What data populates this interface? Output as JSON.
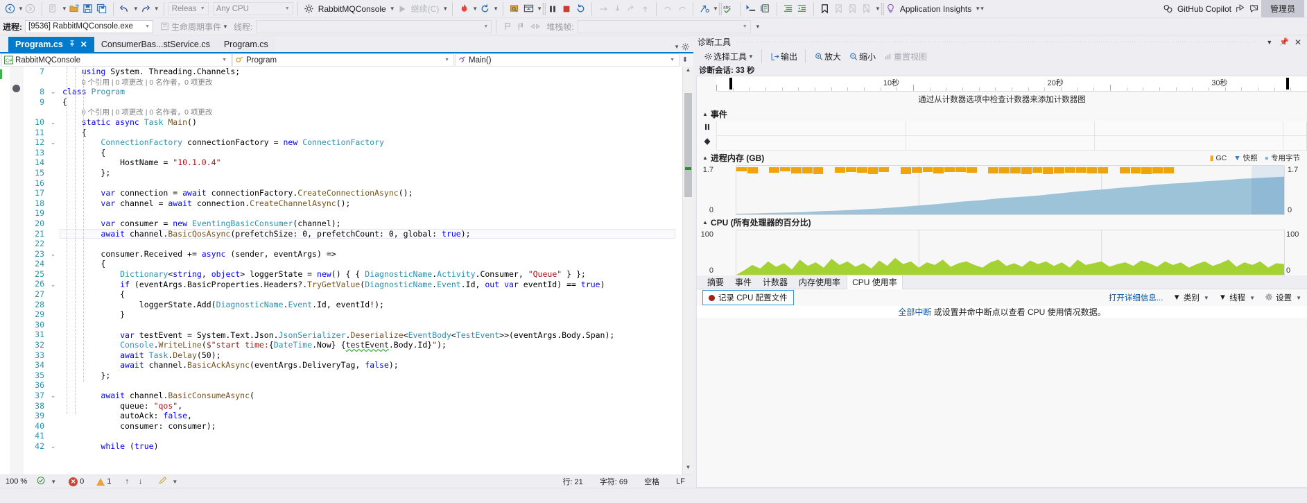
{
  "toolbar": {
    "nav_back": "◀",
    "nav_fwd": "▶",
    "config": "Release",
    "platform": "Any CPU",
    "start_project": "RabbitMQConsole",
    "continue_label": "继续(C)",
    "app_insights": "Application Insights",
    "github_copilot": "GitHub Copilot",
    "admin": "管理员",
    "icons": {
      "back": "back-arrow-icon",
      "forward": "forward-arrow-icon",
      "new_item": "new-item-icon",
      "open": "open-folder-icon",
      "save": "save-icon",
      "save_all": "save-all-icon",
      "undo": "undo-icon",
      "redo": "redo-icon",
      "hot_reload": "hot-reload-icon",
      "restart": "restart-icon",
      "step": "step-icon",
      "break_all": "pause-icon",
      "stop": "stop-icon",
      "restart_debug": "restart-debug-icon",
      "step_into": "step-into-icon",
      "step_over": "step-over-icon",
      "step_out": "step-out-icon",
      "spell": "spell-check-icon",
      "bookmark": "bookmark-icon",
      "lightbulb": "lightbulb-icon"
    }
  },
  "process_bar": {
    "process_label": "进程:",
    "process_value": "[9536] RabbitMQConsole.exe",
    "lifecycle_label": "生命周期事件",
    "thread_label": "线程:",
    "thread_value": "",
    "stackframe_label": "堆栈帧:",
    "stackframe_value": ""
  },
  "tabs": [
    {
      "label": "Program.cs",
      "active": true,
      "pin": "📌",
      "close": "✕"
    },
    {
      "label": "ConsumerBas...stService.cs",
      "active": false
    },
    {
      "label": "Program.cs",
      "active": false
    }
  ],
  "navbar": {
    "project": "RabbitMQConsole",
    "type": "Program",
    "member": "Main()"
  },
  "editor": {
    "first_line": 7,
    "lines": [
      {
        "n": 7,
        "indent": 4,
        "tokens": [
          [
            "kw",
            "using "
          ],
          [
            "pl",
            "System"
          ],
          [
            "pl",
            ". "
          ],
          [
            "pl",
            "Threading"
          ],
          [
            "pl",
            "."
          ],
          [
            "pl",
            "Channels"
          ],
          [
            "pl",
            ";"
          ]
        ]
      },
      {
        "n": null,
        "indent": 4,
        "codelens": "0 个引用 | 0 项更改 | 0 名作者，0 项更改"
      },
      {
        "n": 8,
        "indent": 0,
        "fold": true,
        "tokens": [
          [
            "kw",
            "class "
          ],
          [
            "typ",
            "Program"
          ]
        ]
      },
      {
        "n": 9,
        "indent": 0,
        "tokens": [
          [
            "pl",
            "{"
          ]
        ]
      },
      {
        "n": null,
        "indent": 4,
        "codelens": "0 个引用 | 0 项更改 | 0 名作者，0 项更改"
      },
      {
        "n": 10,
        "indent": 4,
        "fold": true,
        "tokens": [
          [
            "kw",
            "static "
          ],
          [
            "kw",
            "async "
          ],
          [
            "typ",
            "Task "
          ],
          [
            "mth",
            "Main"
          ],
          [
            "pl",
            "()"
          ]
        ]
      },
      {
        "n": 11,
        "indent": 4,
        "tokens": [
          [
            "pl",
            "{"
          ]
        ]
      },
      {
        "n": 12,
        "indent": 8,
        "fold": true,
        "tokens": [
          [
            "typ",
            "ConnectionFactory "
          ],
          [
            "pl",
            "connectionFactory = "
          ],
          [
            "kw",
            "new "
          ],
          [
            "typ",
            "ConnectionFactory"
          ]
        ]
      },
      {
        "n": 13,
        "indent": 8,
        "tokens": [
          [
            "pl",
            "{"
          ]
        ]
      },
      {
        "n": 14,
        "indent": 12,
        "tokens": [
          [
            "pl",
            "HostName = "
          ],
          [
            "str",
            "\"10.1.0.4\""
          ]
        ]
      },
      {
        "n": 15,
        "indent": 8,
        "tokens": [
          [
            "pl",
            "};"
          ]
        ]
      },
      {
        "n": 16,
        "indent": 0,
        "tokens": []
      },
      {
        "n": 17,
        "indent": 8,
        "tokens": [
          [
            "kw",
            "var "
          ],
          [
            "pl",
            "connection = "
          ],
          [
            "kw",
            "await "
          ],
          [
            "pl",
            "connectionFactory."
          ],
          [
            "mth",
            "CreateConnectionAsync"
          ],
          [
            "pl",
            "();"
          ]
        ]
      },
      {
        "n": 18,
        "indent": 8,
        "tokens": [
          [
            "kw",
            "var "
          ],
          [
            "pl",
            "channel = "
          ],
          [
            "kw",
            "await "
          ],
          [
            "pl",
            "connection."
          ],
          [
            "mth",
            "CreateChannelAsync"
          ],
          [
            "pl",
            "();"
          ]
        ]
      },
      {
        "n": 19,
        "indent": 0,
        "tokens": []
      },
      {
        "n": 20,
        "indent": 8,
        "tokens": [
          [
            "kw",
            "var "
          ],
          [
            "pl",
            "consumer = "
          ],
          [
            "kw",
            "new "
          ],
          [
            "typ",
            "EventingBasicConsumer"
          ],
          [
            "pl",
            "(channel);"
          ]
        ]
      },
      {
        "n": 21,
        "indent": 8,
        "current": true,
        "tokens": [
          [
            "kw",
            "await "
          ],
          [
            "pl",
            "channel."
          ],
          [
            "mth",
            "BasicQosAsync"
          ],
          [
            "pl",
            "(prefetchSize: "
          ],
          [
            "num",
            "0"
          ],
          [
            "pl",
            ", prefetchCount: "
          ],
          [
            "num",
            "0"
          ],
          [
            "pl",
            ", global: "
          ],
          [
            "kw",
            "true"
          ],
          [
            "pl",
            ");"
          ]
        ]
      },
      {
        "n": 22,
        "indent": 0,
        "tokens": []
      },
      {
        "n": 23,
        "indent": 8,
        "fold": true,
        "tokens": [
          [
            "pl",
            "consumer.Received += "
          ],
          [
            "kw",
            "async "
          ],
          [
            "pl",
            "(sender, eventArgs) =>"
          ]
        ]
      },
      {
        "n": 24,
        "indent": 8,
        "tokens": [
          [
            "pl",
            "{"
          ]
        ]
      },
      {
        "n": 25,
        "indent": 12,
        "tokens": [
          [
            "typ",
            "Dictionary"
          ],
          [
            "pl",
            "<"
          ],
          [
            "kw",
            "string"
          ],
          [
            "pl",
            ", "
          ],
          [
            "kw",
            "object"
          ],
          [
            "pl",
            "> loggerState = "
          ],
          [
            "kw",
            "new"
          ],
          [
            "pl",
            "() { { "
          ],
          [
            "typ",
            "DiagnosticName"
          ],
          [
            "pl",
            "."
          ],
          [
            "typ",
            "Activity"
          ],
          [
            "pl",
            ".Consumer, "
          ],
          [
            "str",
            "\"Queue\""
          ],
          [
            "pl",
            " } };"
          ]
        ]
      },
      {
        "n": 26,
        "indent": 12,
        "fold": true,
        "tokens": [
          [
            "ctrl",
            "if "
          ],
          [
            "pl",
            "(eventArgs.BasicProperties.Headers?."
          ],
          [
            "mth",
            "TryGetValue"
          ],
          [
            "pl",
            "("
          ],
          [
            "typ",
            "DiagnosticName"
          ],
          [
            "pl",
            "."
          ],
          [
            "typ",
            "Event"
          ],
          [
            "pl",
            ".Id, "
          ],
          [
            "kw",
            "out "
          ],
          [
            "kw",
            "var "
          ],
          [
            "pl",
            "eventId) == "
          ],
          [
            "kw",
            "true"
          ],
          [
            "pl",
            ")"
          ]
        ]
      },
      {
        "n": 27,
        "indent": 12,
        "tokens": [
          [
            "pl",
            "{"
          ]
        ]
      },
      {
        "n": 28,
        "indent": 16,
        "tokens": [
          [
            "pl",
            "loggerState.Add("
          ],
          [
            "typ",
            "DiagnosticName"
          ],
          [
            "pl",
            "."
          ],
          [
            "typ",
            "Event"
          ],
          [
            "pl",
            ".Id, eventId!);"
          ]
        ]
      },
      {
        "n": 29,
        "indent": 12,
        "tokens": [
          [
            "pl",
            "}"
          ]
        ]
      },
      {
        "n": 30,
        "indent": 0,
        "tokens": []
      },
      {
        "n": 31,
        "indent": 12,
        "tokens": [
          [
            "kw",
            "var "
          ],
          [
            "pl",
            "testEvent = System.Text.Json."
          ],
          [
            "typ",
            "JsonSerializer"
          ],
          [
            "pl",
            "."
          ],
          [
            "mth",
            "Deserialize"
          ],
          [
            "pl",
            "<"
          ],
          [
            "typ",
            "EventBody"
          ],
          [
            "pl",
            "<"
          ],
          [
            "typ",
            "TestEvent"
          ],
          [
            "pl",
            ">>(eventArgs.Body.Span);"
          ]
        ]
      },
      {
        "n": 32,
        "indent": 12,
        "tokens": [
          [
            "typ",
            "Console"
          ],
          [
            "pl",
            "."
          ],
          [
            "mth",
            "WriteLine"
          ],
          [
            "pl",
            "("
          ],
          [
            "str",
            "$\"start time:"
          ],
          [
            "pl",
            "{"
          ],
          [
            "typ",
            "DateTime"
          ],
          [
            "pl",
            ".Now} {"
          ],
          [
            "sq",
            "testEvent"
          ],
          [
            "pl",
            ".Body.Id}"
          ],
          [
            "str",
            "\""
          ],
          [
            "pl",
            ");"
          ]
        ]
      },
      {
        "n": 33,
        "indent": 12,
        "tokens": [
          [
            "kw",
            "await "
          ],
          [
            "typ",
            "Task"
          ],
          [
            "pl",
            "."
          ],
          [
            "mth",
            "Delay"
          ],
          [
            "pl",
            "("
          ],
          [
            "num",
            "50"
          ],
          [
            "pl",
            ");"
          ]
        ]
      },
      {
        "n": 34,
        "indent": 12,
        "tokens": [
          [
            "kw",
            "await "
          ],
          [
            "pl",
            "channel."
          ],
          [
            "mth",
            "BasicAckAsync"
          ],
          [
            "pl",
            "(eventArgs.DeliveryTag, "
          ],
          [
            "kw",
            "false"
          ],
          [
            "pl",
            ");"
          ]
        ]
      },
      {
        "n": 35,
        "indent": 8,
        "tokens": [
          [
            "pl",
            "};"
          ]
        ]
      },
      {
        "n": 36,
        "indent": 0,
        "tokens": []
      },
      {
        "n": 37,
        "indent": 8,
        "fold": true,
        "tokens": [
          [
            "kw",
            "await "
          ],
          [
            "pl",
            "channel."
          ],
          [
            "mth",
            "BasicConsumeAsync"
          ],
          [
            "pl",
            "("
          ]
        ]
      },
      {
        "n": 38,
        "indent": 12,
        "tokens": [
          [
            "pl",
            "queue: "
          ],
          [
            "str",
            "\"qos\""
          ],
          [
            "pl",
            ","
          ]
        ]
      },
      {
        "n": 39,
        "indent": 12,
        "tokens": [
          [
            "pl",
            "autoAck: "
          ],
          [
            "kw",
            "false"
          ],
          [
            "pl",
            ","
          ]
        ]
      },
      {
        "n": 40,
        "indent": 12,
        "tokens": [
          [
            "pl",
            "consumer: consumer);"
          ]
        ]
      },
      {
        "n": 41,
        "indent": 0,
        "tokens": []
      },
      {
        "n": 42,
        "indent": 8,
        "fold": true,
        "tokens": [
          [
            "ctrl",
            "while "
          ],
          [
            "pl",
            "("
          ],
          [
            "kw",
            "true"
          ],
          [
            "pl",
            ")"
          ]
        ]
      }
    ]
  },
  "editor_footer": {
    "zoom": "100 %",
    "errors": "0",
    "warnings": "1",
    "line_label": "行: 21",
    "col_label": "字符: 69",
    "spaces_label": "空格",
    "eol_label": "LF"
  },
  "diagnostics": {
    "title": "诊断工具",
    "toolbar": {
      "select_tool": "选择工具",
      "output": "输出",
      "zoom_in": "放大",
      "zoom_out": "缩小",
      "reset_view": "重置视图"
    },
    "session": "诊断会话: 33 秒",
    "timeline_labels": [
      "10秒",
      "20秒",
      "30秒"
    ],
    "counters_note": "通过从计数器选项中检查计数器来添加计数器图",
    "events_group": "事件",
    "memory_group": "进程内存 (GB)",
    "cpu_group": "CPU (所有处理器的百分比)",
    "memory_legend": [
      {
        "mark": "▮",
        "text": "GC",
        "color": "#f0a30a"
      },
      {
        "mark": "▼",
        "text": "快照",
        "color": "#2b7cd3"
      },
      {
        "mark": "●",
        "text": "专用字节",
        "color": "#7fb2d3"
      }
    ],
    "tabs": [
      "摘要",
      "事件",
      "计数器",
      "内存使用率",
      "CPU 使用率"
    ],
    "active_tab": "CPU 使用率",
    "record_button": "记录 CPU 配置文件",
    "details_link": "打开详细信息...",
    "filter_category": "类别",
    "filter_thread": "线程",
    "settings": "设置",
    "center_message_link": "全部中断",
    "center_message_rest": " 或设置并命中断点以查看 CPU 使用情况数据。"
  },
  "chart_data": [
    {
      "type": "area",
      "title": "进程内存 (GB)",
      "ylabel": "",
      "ylim": [
        0,
        1.7
      ],
      "ytick_labels": [
        "1.7",
        "0"
      ],
      "xlabel": "",
      "series": [
        {
          "name": "专用字节",
          "color": "#9dc3d8",
          "values": [
            0.02,
            0.03,
            0.04,
            0.05,
            0.06,
            0.07,
            0.08,
            0.1,
            0.12,
            0.13,
            0.15,
            0.17,
            0.19,
            0.21,
            0.24,
            0.27,
            0.3,
            0.33,
            0.36,
            0.4,
            0.44,
            0.47,
            0.5,
            0.54,
            0.58,
            0.6,
            0.63,
            0.66,
            0.7,
            0.74,
            0.78,
            0.82,
            0.85,
            0.88,
            0.92,
            0.95,
            0.98,
            1.02,
            1.05,
            1.08,
            1.1,
            1.13,
            1.16,
            1.18,
            1.21,
            1.24,
            1.26,
            1.28,
            1.3,
            1.32
          ]
        },
        {
          "name": "GC",
          "color": "#f0a30a",
          "type": "gc-markers",
          "values": [
            1,
            1,
            0,
            1,
            1,
            1,
            1,
            1,
            0,
            1,
            1,
            1,
            1,
            1,
            0,
            1,
            1,
            1,
            1,
            1,
            1,
            1,
            0,
            1,
            1,
            1,
            1,
            1,
            1,
            1,
            1,
            1,
            1,
            1,
            0,
            1,
            1,
            1,
            1,
            1,
            0,
            0,
            0,
            0,
            0,
            0,
            0,
            0,
            0,
            0
          ]
        }
      ],
      "grid": true,
      "legend_position": "top-right"
    },
    {
      "type": "area",
      "title": "CPU (所有处理器的百分比)",
      "ylim": [
        0,
        100
      ],
      "ytick_labels": [
        "100",
        "0"
      ],
      "series": [
        {
          "name": "CPU",
          "color": "#a4d233",
          "values": [
            0,
            10,
            22,
            14,
            30,
            18,
            26,
            12,
            34,
            20,
            28,
            16,
            36,
            22,
            30,
            18,
            26,
            14,
            32,
            20,
            38,
            24,
            30,
            16,
            28,
            22,
            34,
            18,
            26,
            30,
            22,
            16,
            28,
            34,
            20,
            26,
            18,
            32,
            24,
            30,
            20,
            28,
            16,
            34,
            22,
            26,
            30,
            18,
            24,
            28,
            20,
            32,
            26,
            18,
            30,
            22,
            28,
            16,
            24,
            30,
            20,
            26,
            34,
            18,
            28,
            22,
            30,
            16,
            26,
            24
          ]
        }
      ],
      "grid": true
    }
  ]
}
